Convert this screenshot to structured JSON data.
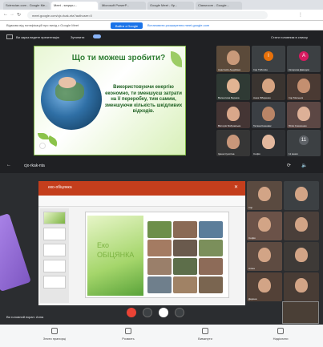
{
  "browser": {
    "tabs": [
      "Sciencian.com - Google Мe...",
      "Meet - seqnpu...",
      "Microsoft PowerP...",
      "Google Meet - бр...",
      "Classroom - Google..."
    ],
    "url": "meet.google.com/cjx-rkak-nta?authuser=0",
    "bookmarks_text": "Відмова від нотифікацій про вихід з Google Meet",
    "bookmarks_btn": "Вийти з Google",
    "bookmarks_link": "Встановити розширення meet.google.com"
  },
  "meet": {
    "presenting_label": "Ви зараз ведете презентацію",
    "present_button": "Зупинити",
    "top_right_text": "Стати головним в списку",
    "slide_title": "Що ти можеш зробити?",
    "slide_body": "Використовуючи енергію економно, ти зменшуєш затрати на її переробку, тим самим, зменшуючи кількість шкідливих відходів.",
    "tiles": [
      {
        "name": "Анастасія Андріївна",
        "bg": "#5b4a3a",
        "kind": "face",
        "face": "#c99a7a"
      },
      {
        "name": "Ігор Тиботкін",
        "bg": "#3c4043",
        "kind": "avatar",
        "initial": "І",
        "color": "#e8710a"
      },
      {
        "name": "Катерина Давидов",
        "bg": "#3c4043",
        "kind": "avatar",
        "initial": "А",
        "color": "#d81b60"
      },
      {
        "name": "Валентина Бережа",
        "bg": "#2f3a34",
        "kind": "face",
        "face": "#e1b493"
      },
      {
        "name": "Анна Лібаренко",
        "bg": "#3a3430",
        "kind": "face",
        "face": "#d6a482"
      },
      {
        "name": "Ігор Мельник",
        "bg": "#4a3a33",
        "kind": "face",
        "face": "#c48f70"
      },
      {
        "name": "Вікторія Бобровська",
        "bg": "#443534",
        "kind": "face",
        "face": "#d9a78a"
      },
      {
        "name": "Тетяна Кошевик",
        "bg": "#3b3f44",
        "kind": "face",
        "face": "#b98567"
      },
      {
        "name": "Юлія Соколенко",
        "bg": "#5c4744",
        "kind": "face",
        "face": "#ddb097"
      },
      {
        "name": "Ірина Сухотіна",
        "bg": "#363636",
        "kind": "face",
        "face": "#c9977a"
      },
      {
        "name": "Софія",
        "bg": "#2e3033",
        "kind": "face",
        "face": "#e3b89e"
      },
      {
        "name": "11 інших",
        "bg": "#3c4043",
        "kind": "avatar",
        "initial": "11",
        "color": "#5f6368"
      }
    ]
  },
  "tablet": {
    "meet_name": "cjx-rkak-nta",
    "ppt_doc": "еко-обіцянка",
    "slide_title_line1": "Еко",
    "slide_title_line2": "ОБІЦЯНКА",
    "you_presenting": "Ви головний екран: Анна",
    "bottom": [
      "Зняти прапорці",
      "Розмить",
      "Вимкнути",
      "Надіслати"
    ],
    "side_tiles": [
      {
        "name": "Ігор",
        "bg": "#5a4a40"
      },
      {
        "name": "",
        "bg": "#3c4043"
      },
      {
        "name": "Софія",
        "bg": "#6b5248"
      },
      {
        "name": "",
        "bg": "#4a3f3a"
      },
      {
        "name": "Аліна",
        "bg": "#5e4b41"
      },
      {
        "name": "",
        "bg": "#3e3a37"
      },
      {
        "name": "Дарина",
        "bg": "#534137"
      },
      {
        "name": "",
        "bg": "#483c35"
      }
    ]
  },
  "colors": {
    "meet_bg": "#202124",
    "ppt_red": "#c43e1c",
    "eco_green": "#7cb342",
    "end_call_red": "#ea4335"
  }
}
